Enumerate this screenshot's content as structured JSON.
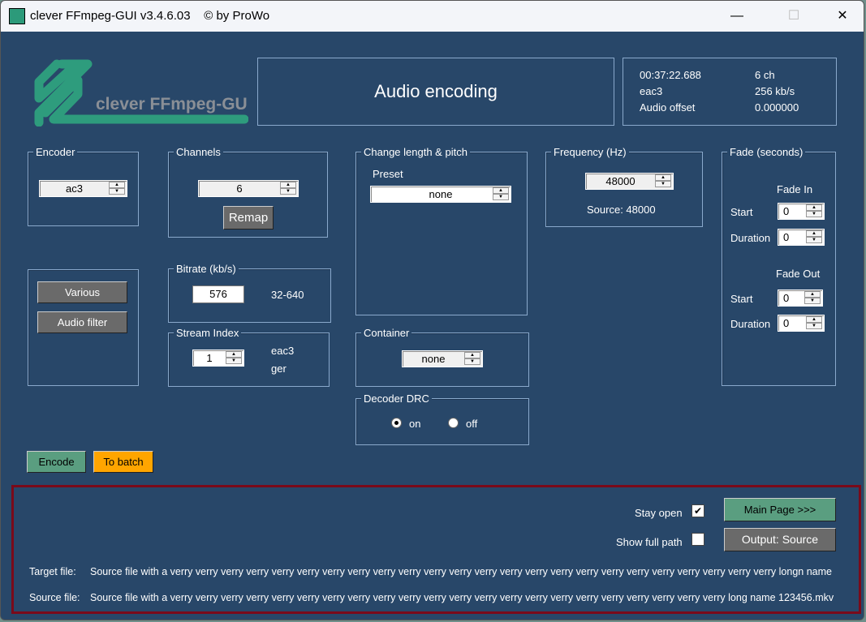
{
  "window": {
    "title": "clever FFmpeg-GUI v3.4.6.03    © by ProWo",
    "minimize": "—",
    "maximize": "☐",
    "close": "✕"
  },
  "logo": {
    "text": "clever FFmpeg-GUI"
  },
  "header": {
    "title": "Audio encoding"
  },
  "info": {
    "duration": "00:37:22.688",
    "channels": "6 ch",
    "codec": "eac3",
    "bitrate": "256 kb/s",
    "offset_label": "Audio offset",
    "offset": "0.000000"
  },
  "encoder": {
    "label": "Encoder",
    "value": "ac3"
  },
  "channels": {
    "label": "Channels",
    "value": "6",
    "remap": "Remap"
  },
  "pitch": {
    "label": "Change length & pitch",
    "preset_label": "Preset",
    "preset": "none"
  },
  "frequency": {
    "label": "Frequency (Hz)",
    "value": "48000",
    "source": "Source: 48000"
  },
  "fade": {
    "label": "Fade (seconds)",
    "fade_in": "Fade In",
    "fade_out": "Fade Out",
    "start": "Start",
    "duration": "Duration",
    "in_start": "0",
    "in_duration": "0",
    "out_start": "0",
    "out_duration": "0"
  },
  "buttons": {
    "various": "Various",
    "audio_filter": "Audio filter",
    "encode": "Encode",
    "to_batch": "To batch",
    "main_page": "Main Page >>>",
    "output": "Output: Source"
  },
  "bitrate": {
    "label": "Bitrate (kb/s)",
    "value": "576",
    "range": "32-640"
  },
  "stream": {
    "label": "Stream Index",
    "value": "1",
    "codec": "eac3",
    "lang": "ger"
  },
  "container": {
    "label": "Container",
    "value": "none"
  },
  "drc": {
    "label": "Decoder DRC",
    "on": "on",
    "off": "off",
    "selected": "on"
  },
  "options": {
    "stay_open": "Stay open",
    "stay_open_checked": true,
    "show_full_path": "Show full path",
    "show_full_path_checked": false,
    "check_mark": "✔"
  },
  "files": {
    "target_label": "Target file:",
    "target": "Source file with a verry verry verry verry verry verry verry verry verry verry verry verry verry verry verry verry verry verry verry verry verry verry verry verry longn name",
    "source_label": "Source file:",
    "source": "Source file with a verry verry verry verry verry verry verry verry verry verry verry verry verry verry verry verry verry verry verry verry verry verry long name 123456.mkv"
  },
  "colors": {
    "bg": "#284769",
    "green": "#5a9e80",
    "orange": "#ffa500",
    "frame": "#7a0a1a"
  }
}
